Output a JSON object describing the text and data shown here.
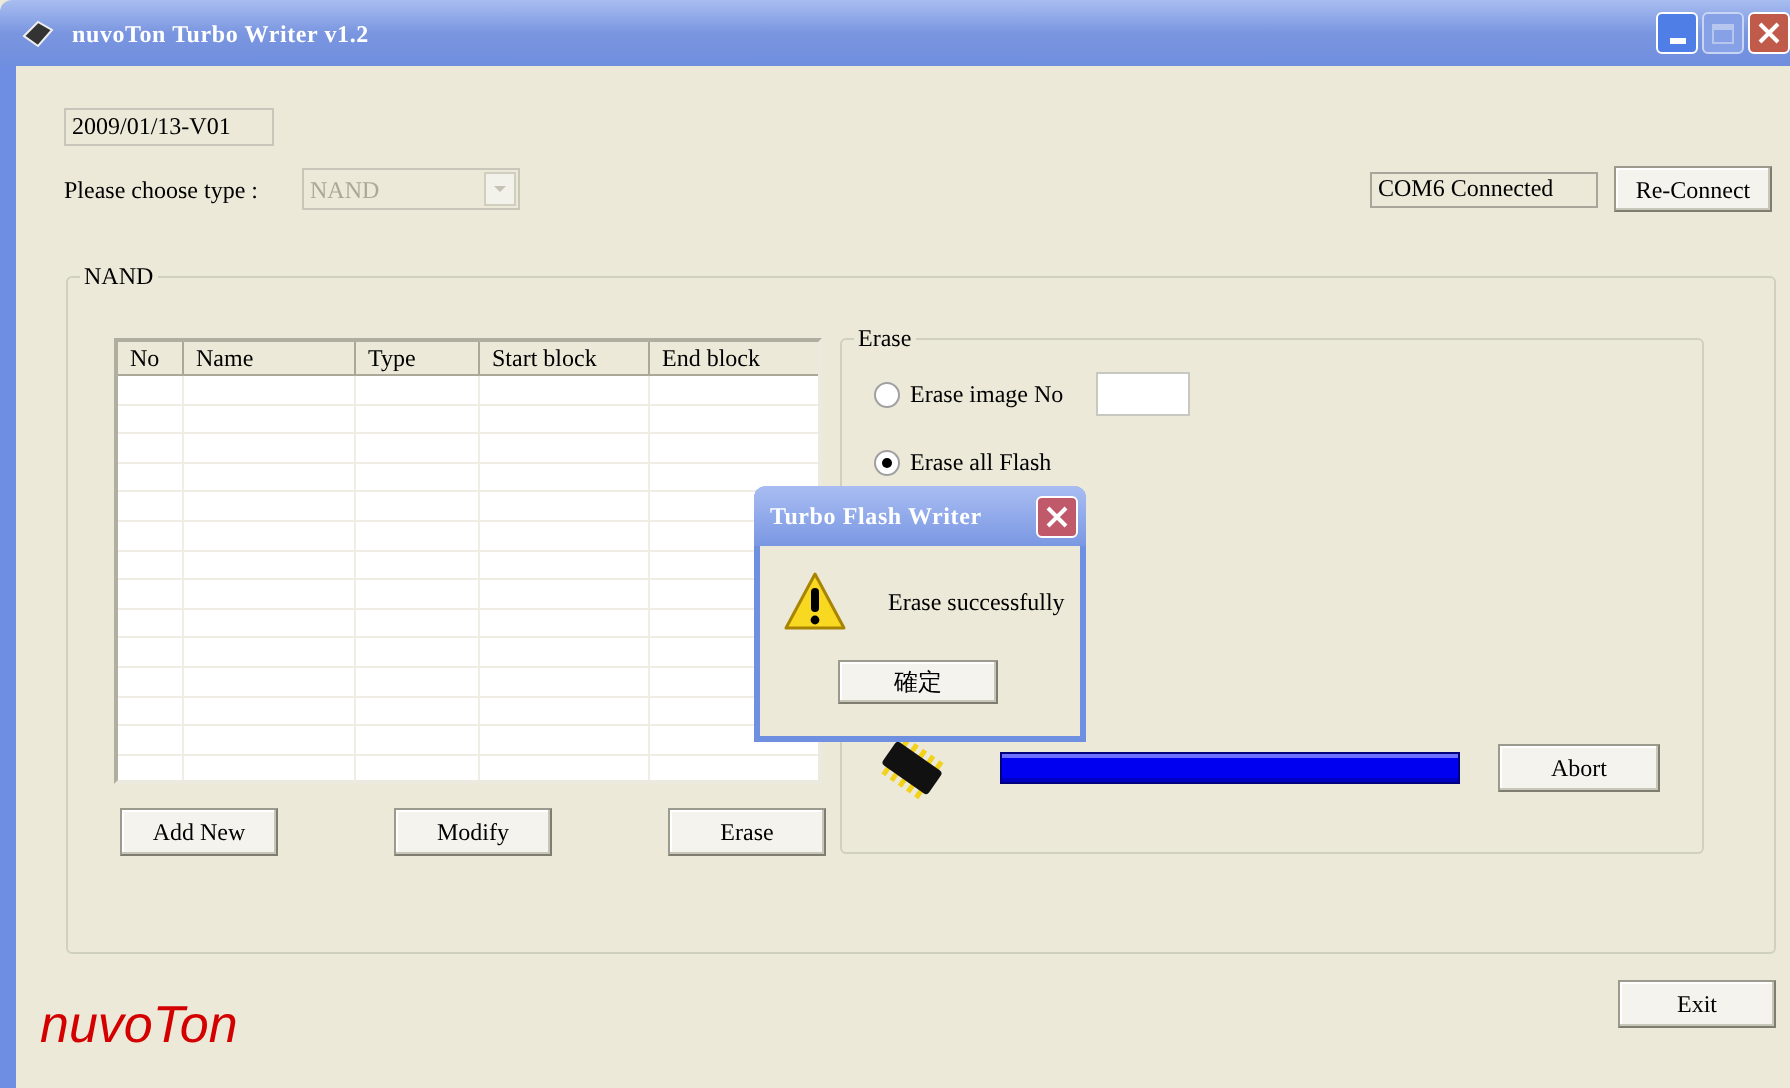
{
  "window": {
    "title": "nuvoTon Turbo Writer v1.2"
  },
  "version": "2009/01/13-V01",
  "type_select": {
    "label": "Please choose type :",
    "value": "NAND",
    "disabled": true
  },
  "connection_status": "COM6 Connected",
  "reconnect_button": "Re-Connect",
  "nand_group": {
    "title": "NAND",
    "table": {
      "columns": [
        "No",
        "Name",
        "Type",
        "Start block",
        "End block"
      ]
    },
    "buttons": [
      "Add New",
      "Modify",
      "Erase"
    ]
  },
  "erase_group": {
    "title": "Erase",
    "options": [
      {
        "kind": "input",
        "label": "Erase image No",
        "selected": false
      },
      {
        "kind": "plain",
        "label": "Erase all Flash",
        "selected": true
      }
    ],
    "progress": {
      "level": 1
    },
    "abort_button": "Abort"
  },
  "exit_button": "Exit",
  "logo": "nuvoTon",
  "dialog": {
    "title": "Turbo Flash Writer",
    "message": "Erase successfully",
    "ok_button": "確定"
  }
}
